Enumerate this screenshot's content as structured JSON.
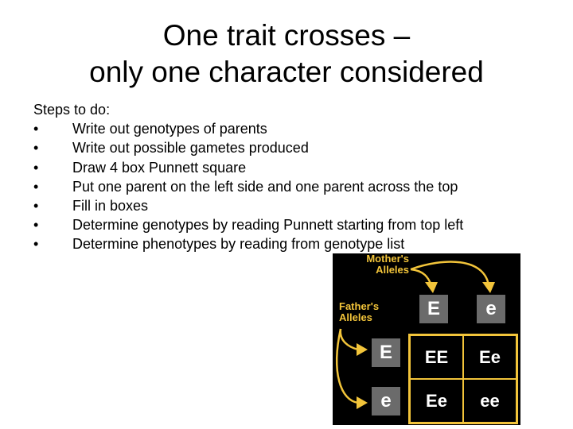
{
  "title": {
    "line1": "One trait crosses –",
    "line2": "only one character considered"
  },
  "steps": {
    "heading": "Steps to do:",
    "bullet": "•",
    "items": [
      "Write out genotypes of parents",
      "Write out possible gametes produced",
      "Draw 4 box Punnett square",
      "Put one parent on the left side and one parent across the top",
      "Fill in boxes",
      "Determine genotypes by reading Punnett starting from top left",
      "Determine phenotypes by reading from genotype list"
    ]
  },
  "punnett": {
    "mother_label": "Mother's\nAlleles",
    "father_label": "Father's\nAlleles",
    "mother_alleles": [
      "E",
      "e"
    ],
    "father_alleles": [
      "E",
      "e"
    ],
    "cells": [
      [
        "EE",
        "Ee"
      ],
      [
        "Ee",
        "ee"
      ]
    ],
    "colors": {
      "accent": "#f2c43a",
      "allele_box": "#6b6b6b",
      "background": "#000000"
    }
  }
}
